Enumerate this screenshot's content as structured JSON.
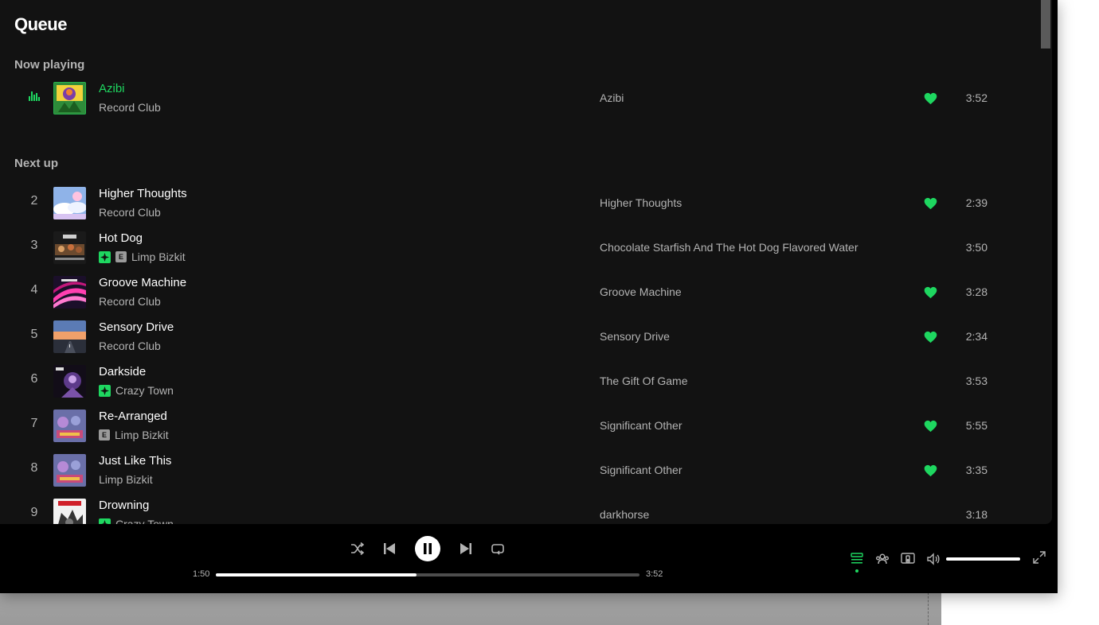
{
  "page": {
    "title": "Queue"
  },
  "sections": {
    "now_playing": "Now playing",
    "next_up": "Next up"
  },
  "now_playing": {
    "title": "Azibi",
    "artist": "Record Club",
    "album": "Azibi",
    "duration": "3:52",
    "liked": true
  },
  "queue": [
    {
      "num": "2",
      "title": "Higher Thoughts",
      "artist": "Record Club",
      "album": "Higher Thoughts",
      "duration": "2:39",
      "liked": true,
      "downloaded": false,
      "explicit": false
    },
    {
      "num": "3",
      "title": "Hot Dog",
      "artist": "Limp Bizkit",
      "album": "Chocolate Starfish And The Hot Dog Flavored Water",
      "duration": "3:50",
      "liked": false,
      "downloaded": true,
      "explicit": true
    },
    {
      "num": "4",
      "title": "Groove Machine",
      "artist": "Record Club",
      "album": "Groove Machine",
      "duration": "3:28",
      "liked": true,
      "downloaded": false,
      "explicit": false
    },
    {
      "num": "5",
      "title": "Sensory Drive",
      "artist": "Record Club",
      "album": "Sensory Drive",
      "duration": "2:34",
      "liked": true,
      "downloaded": false,
      "explicit": false
    },
    {
      "num": "6",
      "title": "Darkside",
      "artist": "Crazy Town",
      "album": "The Gift Of Game",
      "duration": "3:53",
      "liked": false,
      "downloaded": true,
      "explicit": false
    },
    {
      "num": "7",
      "title": "Re-Arranged",
      "artist": "Limp Bizkit",
      "album": "Significant Other",
      "duration": "5:55",
      "liked": true,
      "downloaded": false,
      "explicit": true
    },
    {
      "num": "8",
      "title": "Just Like This",
      "artist": "Limp Bizkit",
      "album": "Significant Other",
      "duration": "3:35",
      "liked": true,
      "downloaded": false,
      "explicit": false
    },
    {
      "num": "9",
      "title": "Drowning",
      "artist": "Crazy Town",
      "album": "darkhorse",
      "duration": "3:18",
      "liked": false,
      "downloaded": true,
      "explicit": false
    }
  ],
  "badges": {
    "explicit": "E"
  },
  "player": {
    "elapsed": "1:50",
    "total": "3:52",
    "progress": 0.474,
    "volume": 1.0
  },
  "colors": {
    "accent": "#1ed760",
    "background": "#121212",
    "player_bg": "#000000",
    "text_secondary": "#b3b3b3"
  },
  "icons": {
    "shuffle": "shuffle-icon",
    "previous": "skip-back-icon",
    "pause": "pause-icon",
    "next": "skip-forward-icon",
    "repeat": "repeat-icon",
    "queue": "queue-icon",
    "friends": "friend-activity-icon",
    "device": "connect-device-icon",
    "volume": "volume-icon",
    "fullscreen": "fullscreen-icon",
    "like": "heart-icon",
    "download": "downloaded-icon",
    "equalizer": "equalizer-icon"
  }
}
